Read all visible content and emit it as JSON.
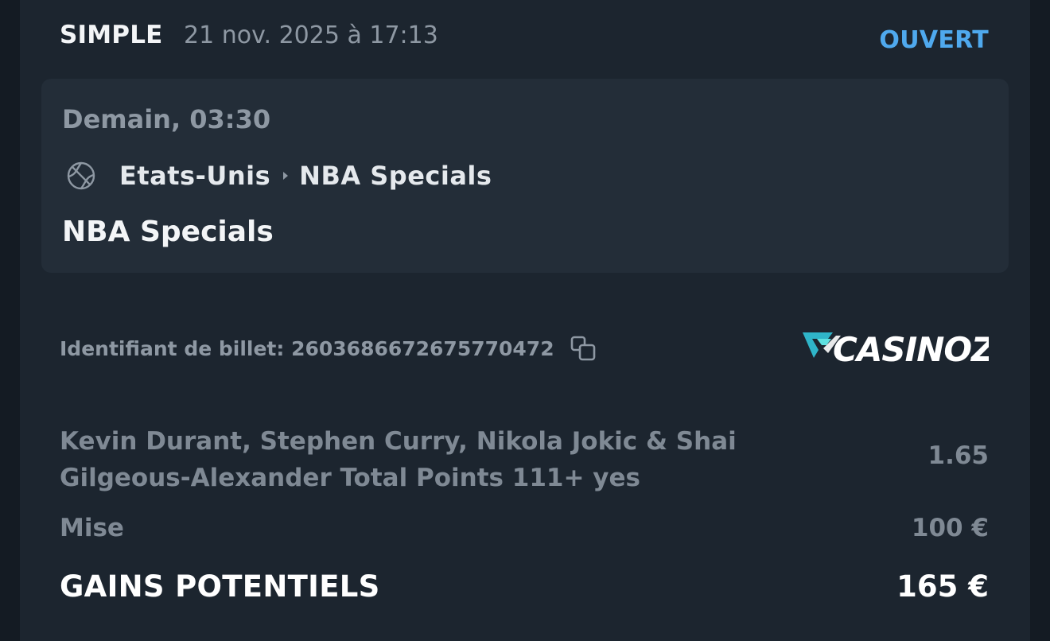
{
  "header": {
    "bet_type": "SIMPLE",
    "bet_date": "21 nov. 2025 à 17:13",
    "status": "OUVERT",
    "status_color": "#4fa9ee"
  },
  "event": {
    "time": "Demain, 03:30",
    "sport_icon": "basketball-icon",
    "country": "Etats-Unis",
    "league": "NBA Specials",
    "name": "NBA Specials"
  },
  "ticket": {
    "label": "Identifiant de billet: 2603686672675770472",
    "copy_icon": "copy-icon"
  },
  "brand": {
    "logo_text": "CASINOZER"
  },
  "selection": {
    "description": "Kevin Durant, Stephen Curry, Nikola Jokic & Shai Gilgeous-Alexander Total Points 111+ yes",
    "odds": "1.65"
  },
  "stake": {
    "label": "Mise",
    "value": "100 €"
  },
  "gains": {
    "label": "GAINS POTENTIELS",
    "value": "165 €"
  }
}
